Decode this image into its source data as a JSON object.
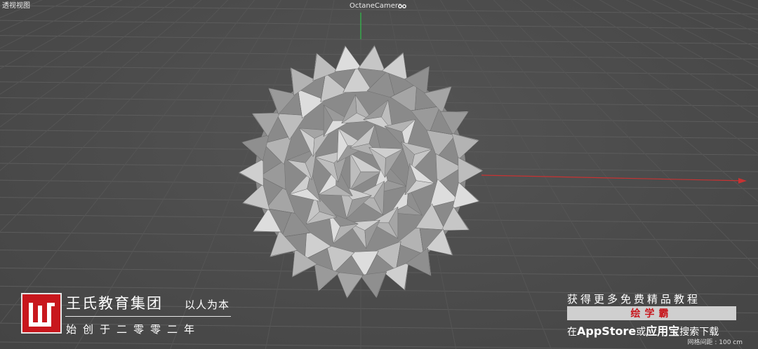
{
  "viewport": {
    "view_name": "透视视图",
    "camera_name": "OctaneCamera",
    "camera_icon": "camera-icon",
    "grid_spacing": "网格间距 : 100 cm",
    "axis_colors": {
      "x": "#c83232",
      "y": "#2fbf4a"
    },
    "background": "#4a4a4a"
  },
  "brand": {
    "logo_icon": "wang-logo-icon",
    "logo_color": "#c8171d",
    "name": "王氏教育集团",
    "slogan": "以人为本",
    "tagline": "始创于二零零二年"
  },
  "promo": {
    "line1": "获得更多免费精品教程",
    "banner": "绘学霸",
    "line3_prefix": "在",
    "line3_app": "AppStore",
    "line3_mid": "或",
    "line3_store": "应用宝",
    "line3_suffix": "搜索下载"
  }
}
